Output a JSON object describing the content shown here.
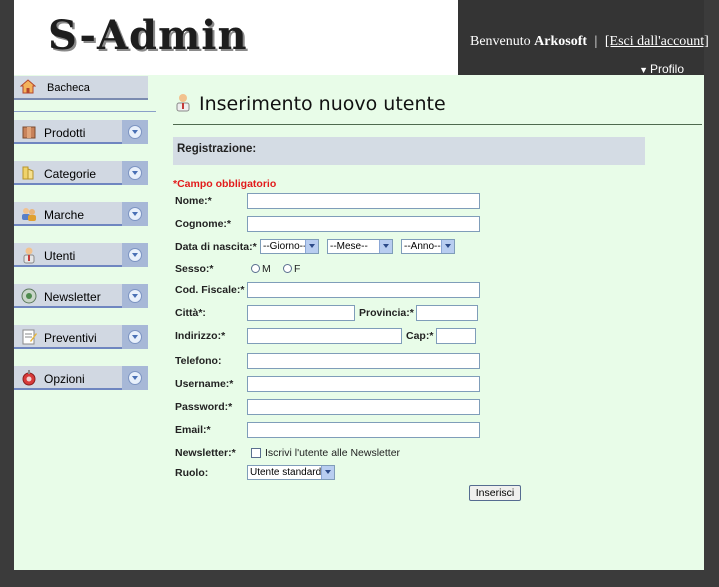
{
  "header": {
    "logo_text": "S-Admin",
    "welcome_prefix": "Benvenuto",
    "username": "Arkosoft",
    "separator": "|",
    "logout_link": "[Esci dall'account]",
    "profile_label": "Profilo"
  },
  "sidebar": {
    "home_label": "Bacheca",
    "items": [
      {
        "label": "Prodotti",
        "icon": "box-icon"
      },
      {
        "label": "Categorie",
        "icon": "folder-icon"
      },
      {
        "label": "Marche",
        "icon": "users-icon"
      },
      {
        "label": "Utenti",
        "icon": "user-icon"
      },
      {
        "label": "Newsletter",
        "icon": "newsletter-icon"
      },
      {
        "label": "Preventivi",
        "icon": "document-icon"
      },
      {
        "label": "Opzioni",
        "icon": "settings-icon"
      }
    ]
  },
  "main": {
    "title": "Inserimento nuovo utente",
    "section_title": "Registrazione:",
    "required_note": "*Campo obbligatorio",
    "labels": {
      "nome": "Nome:*",
      "cognome": "Cognome:*",
      "data_nascita": "Data di nascita:*",
      "sesso": "Sesso:*",
      "cod_fiscale": "Cod. Fiscale:*",
      "citta": "Città*:",
      "provincia": "Provincia:*",
      "indirizzo": "Indirizzo:*",
      "cap": "Cap:*",
      "telefono": "Telefono:",
      "username": "Username:*",
      "password": "Password:*",
      "email": "Email:*",
      "newsletter": "Newsletter:*",
      "ruolo": "Ruolo:"
    },
    "selects": {
      "giorno": "--Giorno--",
      "mese": "--Mese--",
      "anno": "--Anno--",
      "ruolo": "Utente standard"
    },
    "radios": {
      "male": "M",
      "female": "F"
    },
    "newsletter_checkbox": "Iscrivi l'utente alle Newsletter",
    "submit_label": "Inserisci"
  },
  "colors": {
    "page_background": "#e8fce8",
    "header_dark": "#343434",
    "sidebar_item": "#d1d8e2",
    "required_red": "#e21b1b"
  }
}
